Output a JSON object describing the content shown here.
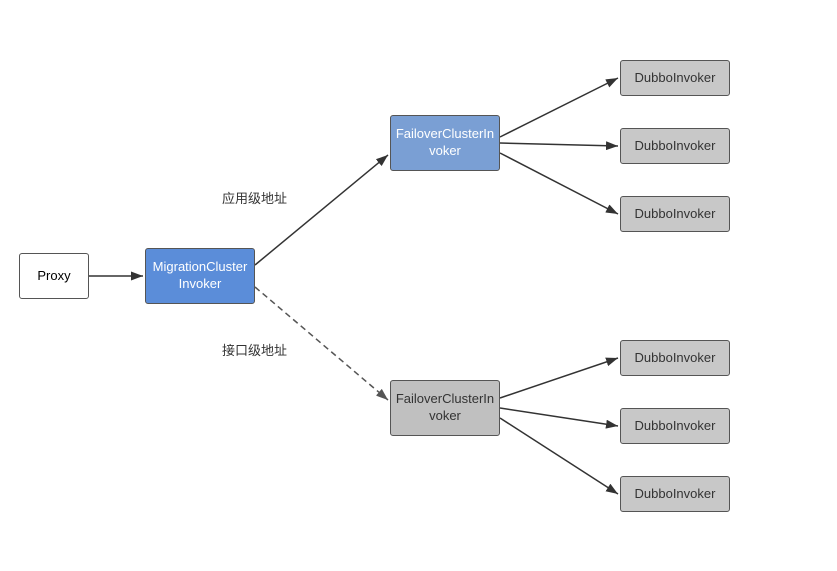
{
  "nodes": {
    "proxy": {
      "label": "Proxy"
    },
    "migration": {
      "label": "MigrationCluster\nInvoker"
    },
    "failover_top": {
      "label": "FailoverClusterIn\nvoker"
    },
    "failover_bottom": {
      "label": "FailoverClusterIn\nvoker"
    },
    "dubbo_label": "DubboInvoker"
  },
  "labels": {
    "top_path": "应用级地址",
    "bottom_path": "接口级地址"
  }
}
